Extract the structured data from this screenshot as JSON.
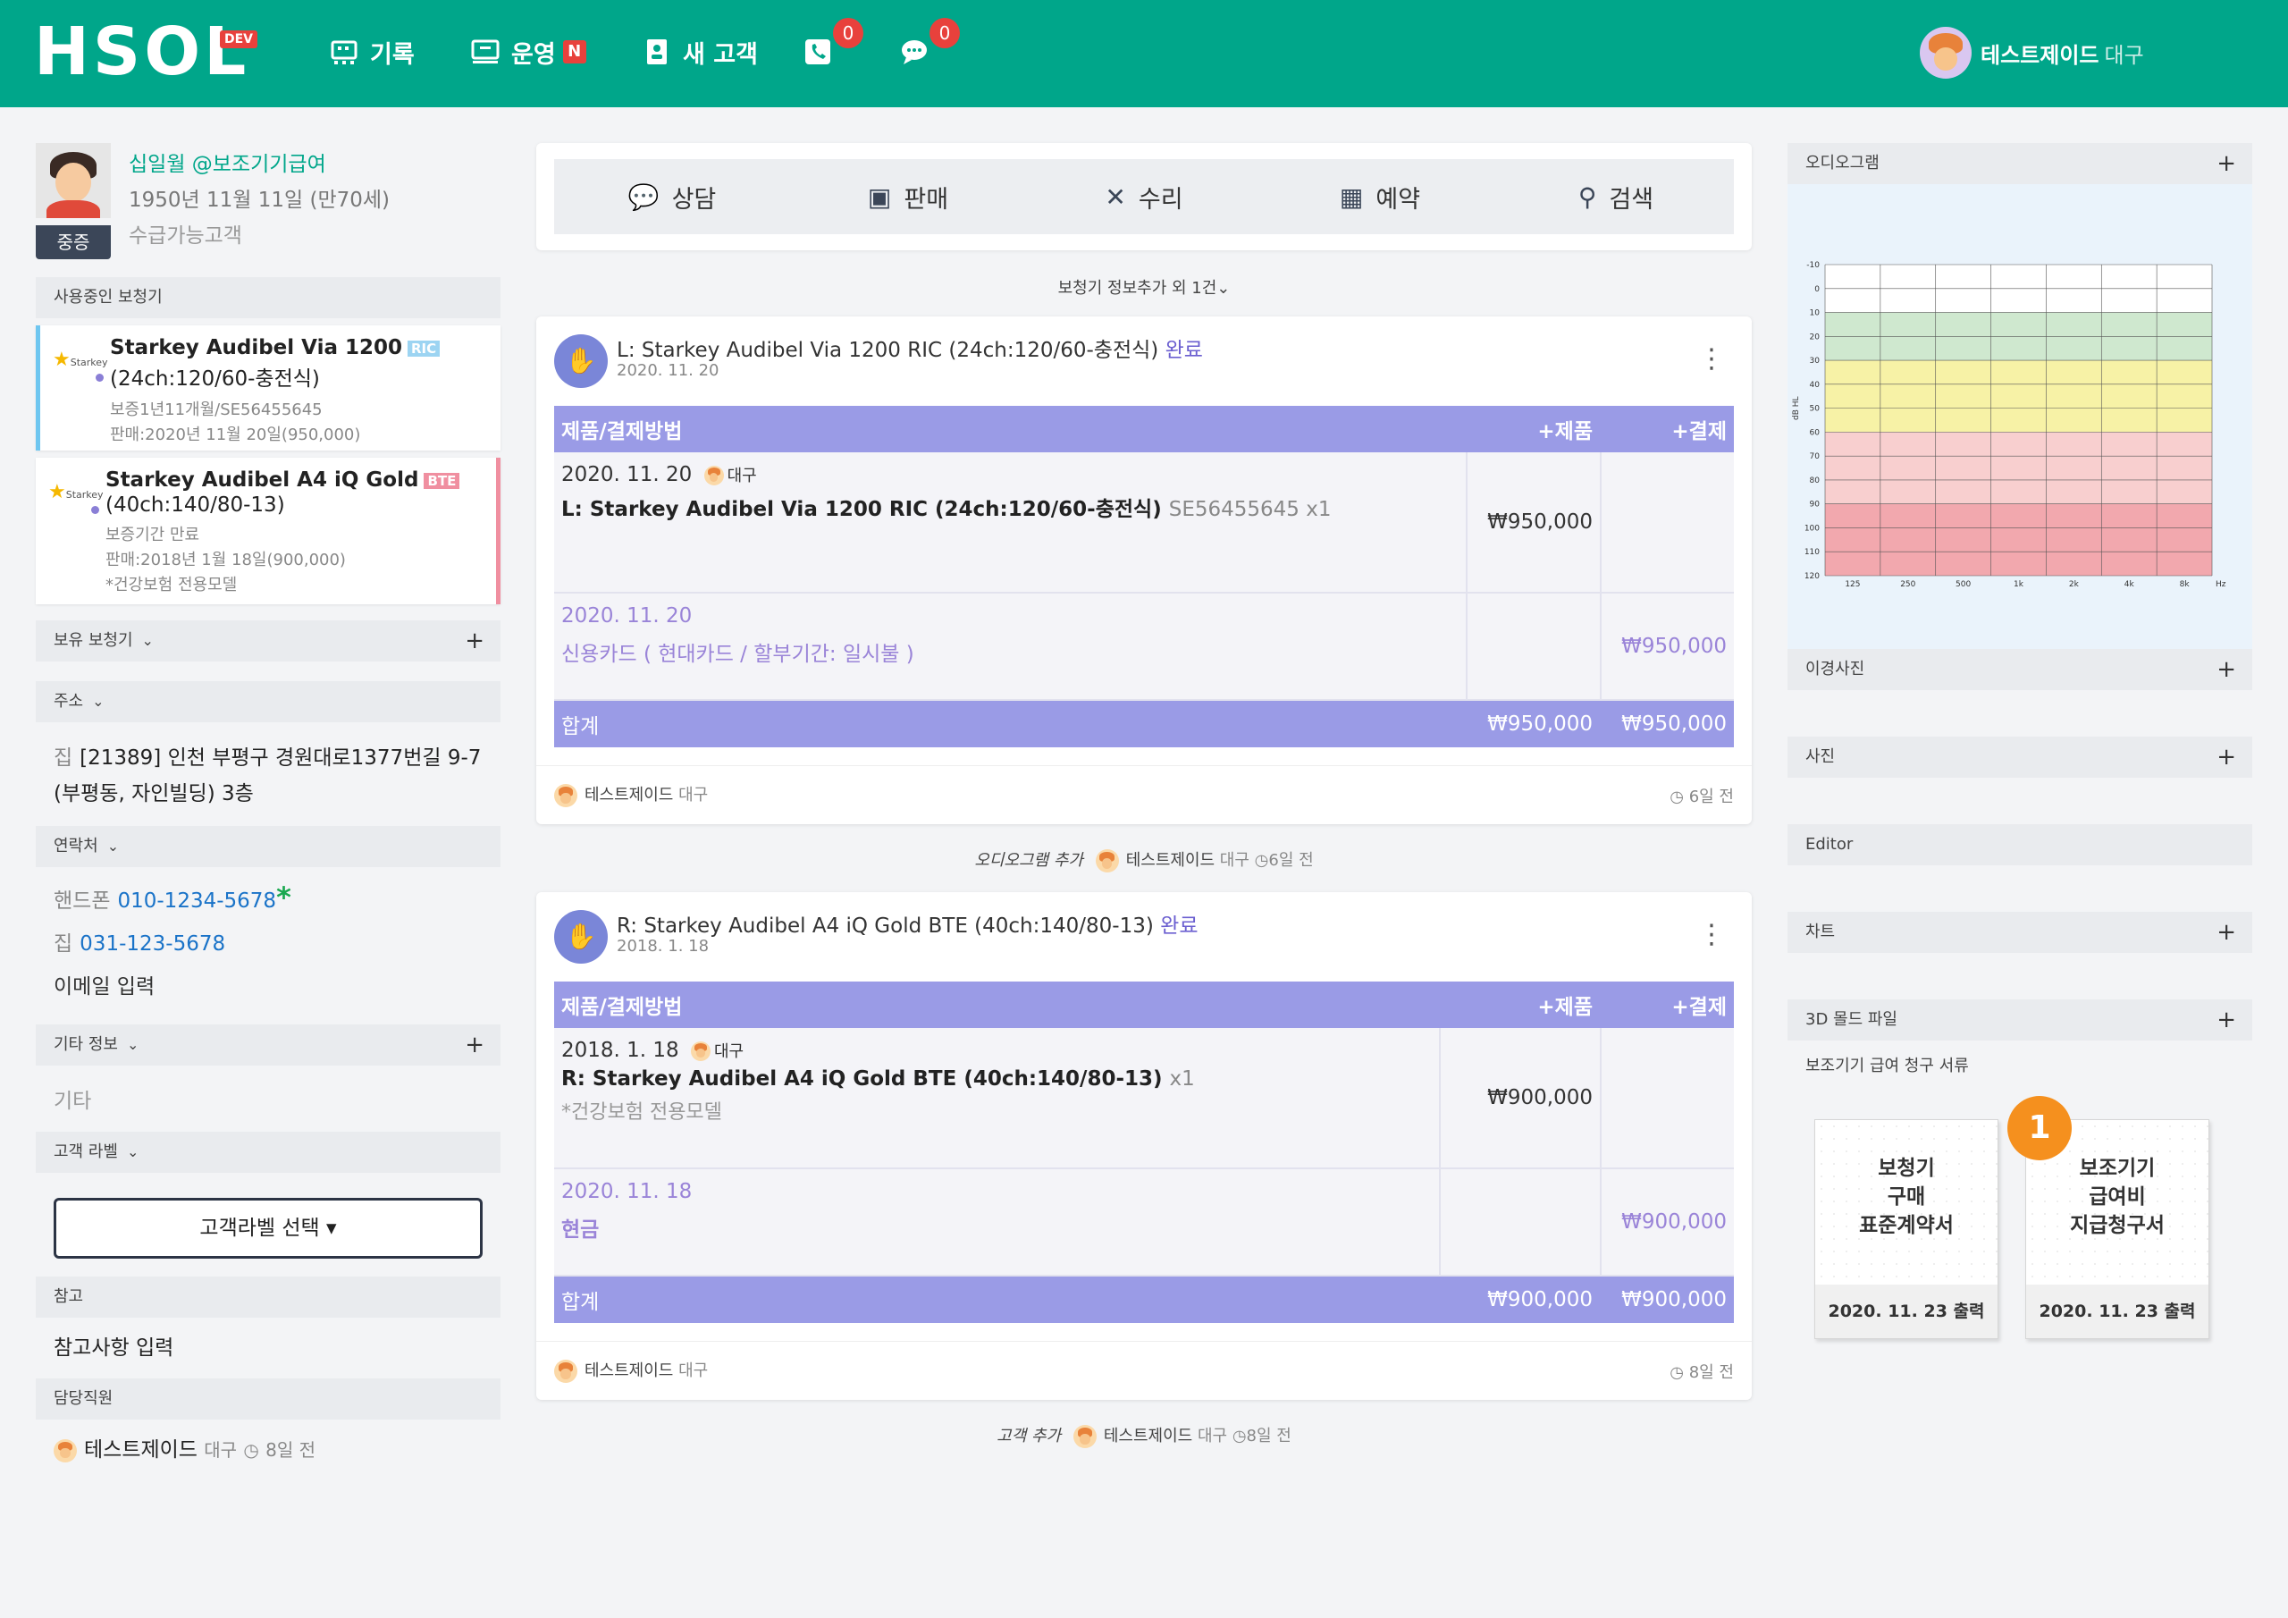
{
  "header": {
    "logo": "HSOL",
    "logo_badge": "DEV",
    "nav": [
      {
        "label": "기록",
        "icon": "records-icon"
      },
      {
        "label": "운영",
        "icon": "operation-icon",
        "badge": "N"
      },
      {
        "label": "새 고객",
        "icon": "new-customer-icon"
      }
    ],
    "phone_count": "0",
    "message_count": "0",
    "user_name": "테스트제이드",
    "user_branch": "대구"
  },
  "patient": {
    "name": "십일월 @보조기기급여",
    "dob": "1950년 11월 11일 (만70세)",
    "status": "수급가능고객",
    "severity": "중증"
  },
  "left": {
    "devices_in_use_label": "사용중인 보청기",
    "devices": [
      {
        "brand": "Starkey",
        "title": "Starkey Audibel Via 1200",
        "tag": "RIC",
        "spec": "(24ch:120/60-충전식)",
        "meta1": "보증1년11개월/SE56455645",
        "meta2": "판매:2020년 11월 20일(950,000)",
        "meta3": ""
      },
      {
        "brand": "Starkey",
        "title": "Starkey Audibel A4 iQ Gold",
        "tag": "BTE",
        "spec": "(40ch:140/80-13)",
        "meta1": "보증기간 만료",
        "meta2": "판매:2018년 1월 18일(900,000)",
        "meta3": "*건강보험 전용모델"
      }
    ],
    "owned_devices_label": "보유 보청기",
    "address_label": "주소",
    "address_type": "집",
    "address_line1": "[21389] 인천 부평구 경원대로1377번길 9-7",
    "address_line2": "(부평동, 자인빌딩) 3층",
    "contact_label": "연락처",
    "mobile_label": "핸드폰",
    "mobile": "010-1234-5678",
    "mobile_mark": "*",
    "home_label": "집",
    "home": "031-123-5678",
    "email": "이메일 입력",
    "other_label": "기타 정보",
    "other_value": "기타",
    "customer_label_label": "고객 라벨",
    "customer_label_button": "고객라벨 선택 ▾",
    "note_label": "참고",
    "note_value": "참고사항 입력",
    "staff_label": "담당직원",
    "staff_name": "테스트제이드",
    "staff_branch": "대구",
    "staff_ago": "8일 전"
  },
  "tabs": [
    {
      "label": "상담",
      "icon": "chat-icon"
    },
    {
      "label": "판매",
      "icon": "sale-icon"
    },
    {
      "label": "수리",
      "icon": "repair-icon"
    },
    {
      "label": "예약",
      "icon": "calendar-icon"
    },
    {
      "label": "검색",
      "icon": "search-icon"
    }
  ],
  "more_info": "보청기 정보추가 외 1건⌄",
  "cards": [
    {
      "title": "L: Starkey Audibel Via 1200 RIC (24ch:120/60-충전식)",
      "status": "완료",
      "date": "2020. 11. 20",
      "col_product": "제품/결제방법",
      "col_add_product": "+제품",
      "col_add_payment": "+결제",
      "item_date": "2020. 11. 20",
      "item_staff": "대구",
      "item_name": "L: Starkey Audibel Via 1200 RIC (24ch:120/60-충전식)",
      "item_serial": "SE56455645 x1",
      "item_memo": "",
      "item_price": "₩950,000",
      "pay_date": "2020. 11. 20",
      "pay_method": "신용카드 ( 현대카드 / 할부기간: 일시불 )",
      "pay_amount": "₩950,000",
      "total_label": "합계",
      "total_product": "₩950,000",
      "total_payment": "₩950,000",
      "footer_name": "테스트제이드",
      "footer_branch": "대구",
      "footer_ago": "6일 전"
    },
    {
      "title": "R: Starkey Audibel A4 iQ Gold BTE (40ch:140/80-13)",
      "status": "완료",
      "date": "2018. 1. 18",
      "col_product": "제품/결제방법",
      "col_add_product": "+제품",
      "col_add_payment": "+결제",
      "item_date": "2018. 1. 18",
      "item_staff": "대구",
      "item_name": "R: Starkey Audibel A4 iQ Gold BTE (40ch:140/80-13)",
      "item_serial": "x1",
      "item_memo": "*건강보험 전용모델",
      "item_price": "₩900,000",
      "pay_date": "2020. 11. 18",
      "pay_method": "현금",
      "pay_amount": "₩900,000",
      "total_label": "합계",
      "total_product": "₩900,000",
      "total_payment": "₩900,000",
      "footer_name": "테스트제이드",
      "footer_branch": "대구",
      "footer_ago": "8일 전"
    }
  ],
  "history1": {
    "action": "오디오그램 추가",
    "name": "테스트제이드",
    "branch": "대구",
    "ago": "6일 전"
  },
  "history2": {
    "action": "고객 추가",
    "name": "테스트제이드",
    "branch": "대구",
    "ago": "8일 전"
  },
  "right": {
    "audiogram_label": "오디오그램",
    "otoscope_label": "이경사진",
    "photo_label": "사진",
    "editor_label": "Editor",
    "chart_label": "차트",
    "mold_label": "3D 몰드 파일",
    "forms_label": "보조기기 급여 청구 서류",
    "docs": [
      {
        "title": "보청기\n구매\n표준계약서",
        "printed": "2020. 11. 23 출력"
      },
      {
        "title": "보조기기\n급여비\n지급청구서",
        "printed": "2020. 11. 23 출력"
      }
    ],
    "step_badge": "1"
  },
  "audiogram_axes": {
    "y_unit": "dB HL",
    "x_unit": "Hz",
    "y_ticks": [
      "-10",
      "0",
      "10",
      "20",
      "30",
      "40",
      "50",
      "60",
      "70",
      "80",
      "90",
      "100",
      "110",
      "120"
    ],
    "x_ticks": [
      "125",
      "250",
      "500",
      "1k",
      "2k",
      "4k",
      "8k"
    ]
  },
  "colors": {
    "brand": "#00a68a",
    "accent": "#9a9be6",
    "badge": "#e8413c",
    "step": "#f5901e"
  }
}
